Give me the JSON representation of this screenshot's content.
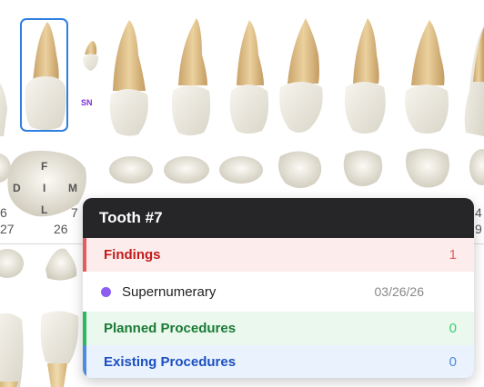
{
  "tooth_chart": {
    "surface_labels": {
      "facial": "F",
      "distal": "D",
      "incisal": "I",
      "mesial": "M",
      "lingual": "L"
    },
    "numbers": {
      "n6": "6",
      "n27": "27",
      "n26": "26",
      "n4": "4",
      "n9": "9",
      "n7_partial": "7"
    },
    "supernumerary_badge": "SN",
    "selected_tooth": 7,
    "colors": {
      "selection": "#2f7fe0",
      "badge": "#7e2ee0"
    }
  },
  "popup": {
    "title": "Tooth #7",
    "findings": {
      "label": "Findings",
      "count": "1",
      "items": [
        {
          "name": "Supernumerary",
          "date": "03/26/26",
          "dot_color": "#8a5cf0"
        }
      ]
    },
    "planned": {
      "label": "Planned Procedures",
      "count": "0"
    },
    "existing": {
      "label": "Existing Procedures",
      "count": "0"
    },
    "colors": {
      "findings": "#c21b1b",
      "planned": "#1a7a35",
      "existing": "#1b4fc0",
      "header": "#262628"
    }
  }
}
